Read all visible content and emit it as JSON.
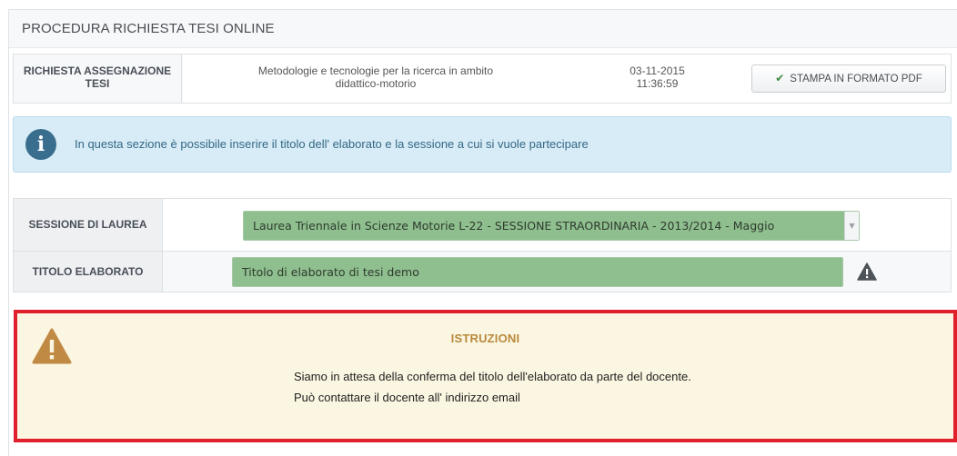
{
  "page": {
    "header_title": "PROCEDURA RICHIESTA TESI ONLINE"
  },
  "request": {
    "label_line1": "RICHIESTA ASSEGNAZIONE",
    "label_line2": "TESI",
    "title_line1": "Metodologie e tecnologie per la ricerca in ambito",
    "title_line2": "didattico-motorio",
    "date": "03-11-2015",
    "time": "11:36:59",
    "pdf_button_label": "STAMPA IN FORMATO PDF"
  },
  "info": {
    "icon": "info-icon",
    "text": "In questa sezione è possibile inserire il titolo dell' elaborato e la sessione a cui si vuole partecipare"
  },
  "form": {
    "session_label": "SESSIONE DI LAUREA",
    "session_value": "Laurea Triennale in Scienze Motorie L-22 - SESSIONE STRAORDINARIA - 2013/2014 - Maggio",
    "title_label": "TITOLO ELABORATO",
    "title_value": "Titolo di elaborato di tesi demo"
  },
  "instructions": {
    "title": "ISTRUZIONI",
    "line1": "Siamo in attesa della conferma del titolo dell'elaborato da parte del docente.",
    "line2": "Può contattare il docente all' indirizzo email"
  },
  "colors": {
    "field_fill": "#8fbf8f",
    "info_bg": "#d7ecf6",
    "warning_bg": "#fbf6e1",
    "highlight_border": "#e0202d",
    "warning_title": "#b8893d"
  }
}
